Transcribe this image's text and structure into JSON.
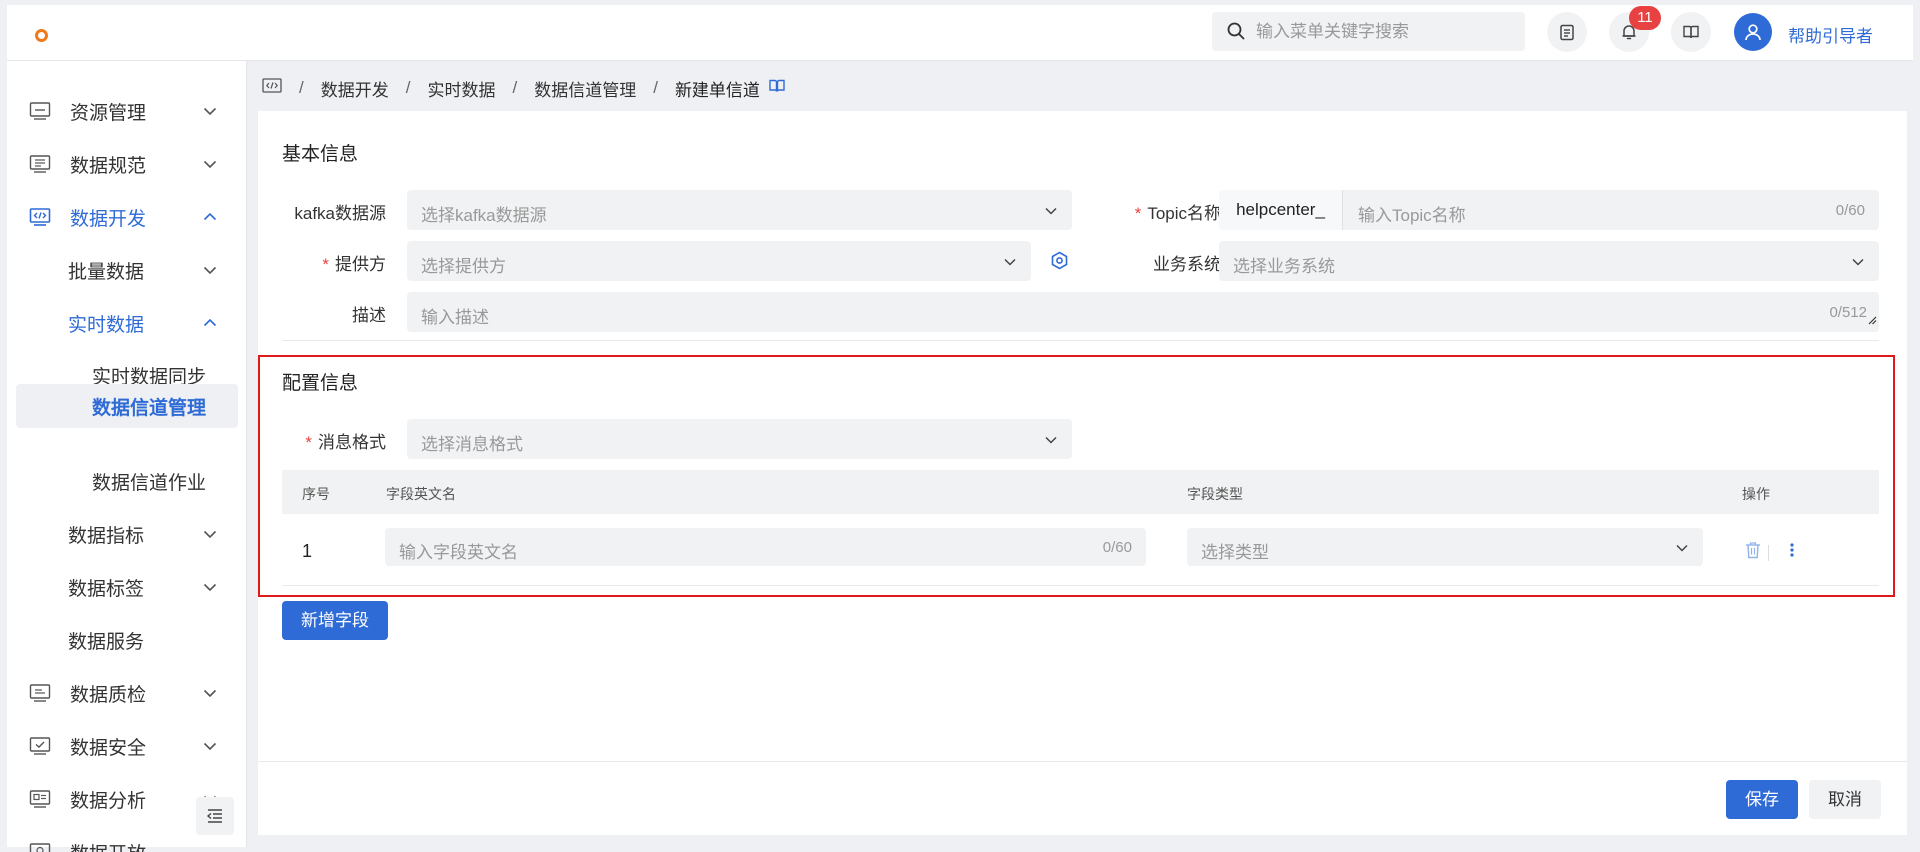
{
  "topbar": {
    "search_placeholder": "输入菜单关键字搜索",
    "notification_count": "11",
    "user_name": "帮助引导者"
  },
  "sidebar": {
    "items": [
      {
        "label": "资源管理",
        "icon": "resource-icon"
      },
      {
        "label": "数据规范",
        "icon": "spec-icon"
      },
      {
        "label": "数据开发",
        "icon": "code-icon"
      },
      {
        "label": "批量数据"
      },
      {
        "label": "实时数据"
      },
      {
        "label": "实时数据同步"
      },
      {
        "label": "数据信道管理"
      },
      {
        "label": "数据信道作业"
      },
      {
        "label": "数据指标"
      },
      {
        "label": "数据标签"
      },
      {
        "label": "数据服务"
      },
      {
        "label": "数据质检",
        "icon": "quality-icon"
      },
      {
        "label": "数据安全",
        "icon": "security-icon"
      },
      {
        "label": "数据分析",
        "icon": "analysis-icon"
      },
      {
        "label": "数据开放",
        "icon": "open-icon"
      }
    ]
  },
  "breadcrumb": {
    "sep": "/",
    "items": [
      "数据开发",
      "实时数据",
      "数据信道管理",
      "新建单信道"
    ]
  },
  "basic": {
    "title": "基本信息",
    "kafka_label": "kafka数据源",
    "kafka_placeholder": "选择kafka数据源",
    "req_mark": "*",
    "topic_label": "Topic名称",
    "topic_prefix": "helpcenter_",
    "topic_placeholder": "输入Topic名称",
    "topic_count": "0/60",
    "provider_label": "提供方",
    "provider_placeholder": "选择提供方",
    "biz_label": "业务系统",
    "biz_placeholder": "选择业务系统",
    "desc_label": "描述",
    "desc_placeholder": "输入描述",
    "desc_count": "0/512"
  },
  "config": {
    "title": "配置信息",
    "format_label": "消息格式",
    "format_placeholder": "选择消息格式",
    "table": {
      "headers": [
        "序号",
        "字段英文名",
        "字段类型",
        "操作"
      ],
      "rows": [
        {
          "num": "1",
          "name_placeholder": "输入字段英文名",
          "name_count": "0/60",
          "type_placeholder": "选择类型"
        }
      ]
    },
    "add_field": "新增字段"
  },
  "footer": {
    "save": "保存",
    "cancel": "取消"
  },
  "colors": {
    "primary": "#2f6bd6",
    "required": "#e84141",
    "highlight_frame": "#e0191b",
    "logo": "#f07a1a"
  }
}
